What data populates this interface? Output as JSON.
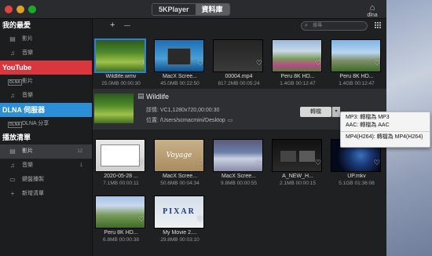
{
  "app": {
    "segment_left": "5KPlayer",
    "segment_right": "資料庫",
    "dlna_label": "dlna"
  },
  "sidebar": {
    "favorites_header": "我的最愛",
    "favorites_items": [
      {
        "label": "影片"
      },
      {
        "label": "音樂"
      }
    ],
    "youtube_header": "YouTube",
    "youtube_items": [
      {
        "label": "影片",
        "badge": "DLNA"
      },
      {
        "label": "音樂"
      }
    ],
    "dlna_header": "DLNA 伺服器",
    "dlna_items": [
      {
        "label": "DLNA 分享",
        "badge": "DLNA"
      }
    ],
    "playlist_header": "播放清單",
    "playlist_items": [
      {
        "label": "影片",
        "count": "12"
      },
      {
        "label": "音樂",
        "count": "1"
      },
      {
        "label": "鍵盤播製"
      },
      {
        "label": "新增清單"
      }
    ]
  },
  "toolbar": {
    "add": "+",
    "remove": "—",
    "search_placeholder": "搜尋"
  },
  "row1": [
    {
      "name": "Wildlife.wmv",
      "meta": "25.0MB 00:00:30",
      "art": "art-wild",
      "selected": true
    },
    {
      "name": "MacX Scree...",
      "meta": "45.0MB 00:22:50",
      "art": "art-win"
    },
    {
      "name": "00004.mp4",
      "meta": "817.2MB 00:05:24",
      "art": "art-mac"
    },
    {
      "name": "Peru 8K HD...",
      "meta": "1.4GB 00:12:47",
      "art": "art-village"
    },
    {
      "name": "Peru 8K HD...",
      "meta": "1.4GB 00:12:47",
      "art": "art-mount"
    }
  ],
  "detail": {
    "title": "Wildlife",
    "info": "詳情: VC1,1280x720,00:00:30",
    "location": "位置: /Users/scmacmini/Desktop",
    "convert": "轉檔"
  },
  "menu": {
    "items": [
      "MP3: 轉檔為 MP3",
      "AAC: 轉檔為 AAC",
      "MP4(H264): 轉檔為 MP4(H264)"
    ]
  },
  "row2": [
    {
      "name": "2020-05-28 ...",
      "meta": "7.1MB 00:00:11",
      "art": "art-desk"
    },
    {
      "name": "MacX Scree...",
      "meta": "50.6MB 00:04:34",
      "art": "art-voyage",
      "overlay": "Voyage"
    },
    {
      "name": "MacX Scree...",
      "meta": "9.8MB 00:00:55",
      "art": "art-yosemite"
    },
    {
      "name": "A_NEW_H...",
      "meta": "2.1MB 00:00:15",
      "art": "art-dark"
    },
    {
      "name": "UP.mkv",
      "meta": "5.1GB 01:36:08",
      "art": "art-space"
    }
  ],
  "row3": [
    {
      "name": "Peru 8K HD...",
      "meta": "6.8MB 00:00:38",
      "art": "art-peru2"
    },
    {
      "name": "My Movie 2....",
      "meta": "29.8MB 00:03:10",
      "art": "art-pixar",
      "overlay": "PIXAR"
    }
  ]
}
